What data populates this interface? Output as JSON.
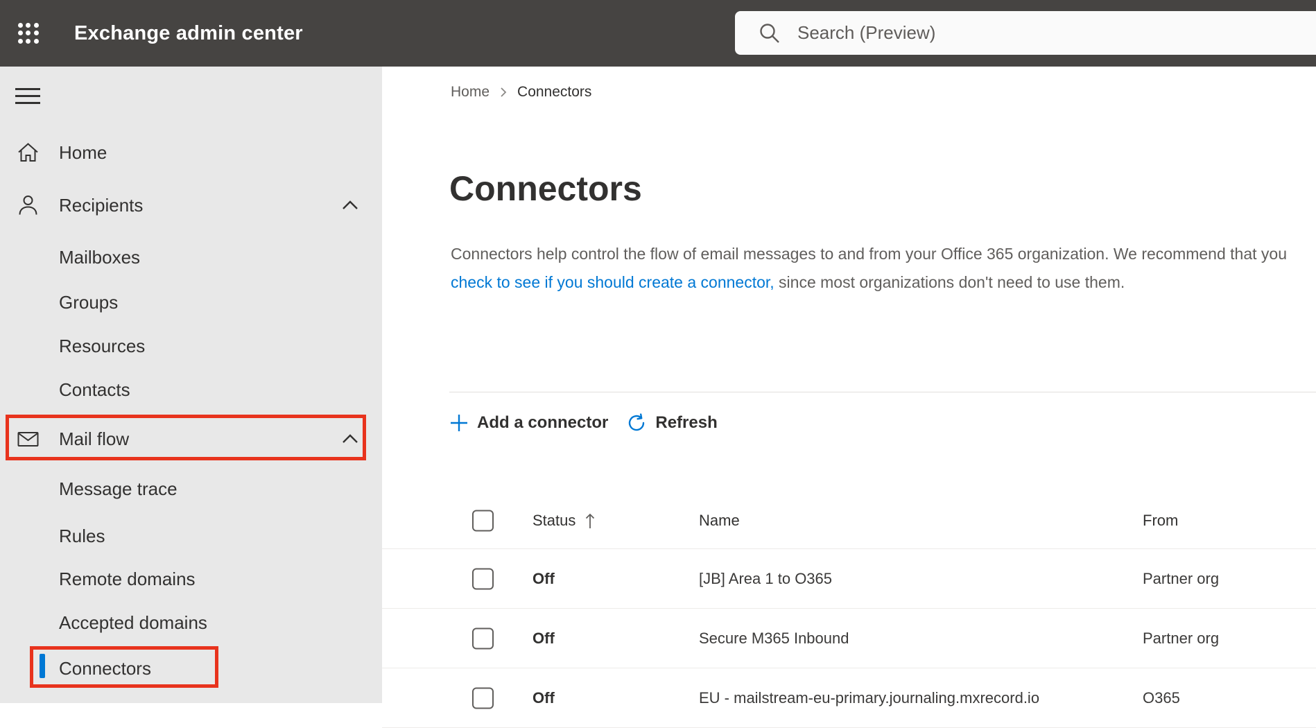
{
  "app": {
    "title": "Exchange admin center",
    "search_placeholder": "Search (Preview)"
  },
  "colors": {
    "topbar_bg": "#464442",
    "sidebar_bg": "#e8e8e8",
    "accent_blue": "#0078d4",
    "link_blue": "#0078d4",
    "annotation_red": "#e8331d",
    "text_dark": "#323130",
    "text_gray": "#605e5c"
  },
  "sidebar": {
    "items": [
      {
        "label": "Home",
        "icon": "home-icon"
      },
      {
        "label": "Recipients",
        "icon": "person-icon",
        "expanded": true
      },
      {
        "label": "Mailboxes"
      },
      {
        "label": "Groups"
      },
      {
        "label": "Resources"
      },
      {
        "label": "Contacts"
      },
      {
        "label": "Mail flow",
        "icon": "mail-icon",
        "expanded": true,
        "annotated": true
      },
      {
        "label": "Message trace"
      },
      {
        "label": "Rules"
      },
      {
        "label": "Remote domains"
      },
      {
        "label": "Accepted domains"
      },
      {
        "label": "Connectors",
        "selected": true,
        "annotated": true
      }
    ]
  },
  "breadcrumb": {
    "home": "Home",
    "current": "Connectors"
  },
  "page": {
    "title": "Connectors",
    "description_before_link": "Connectors help control the flow of email messages to and from your Office 365 organization. We recommend that you ",
    "description_link": "check to see if you should create a connector,",
    "description_after_link": " since most organizations don't need to use them."
  },
  "toolbar": {
    "add_label": "Add a connector",
    "refresh_label": "Refresh"
  },
  "table": {
    "headers": {
      "status": "Status",
      "name": "Name",
      "from": "From"
    },
    "sort": {
      "column": "Status",
      "direction": "ascending"
    },
    "rows": [
      {
        "status": "Off",
        "name": "[JB] Area 1 to O365",
        "from": "Partner org"
      },
      {
        "status": "Off",
        "name": "Secure M365 Inbound",
        "from": "Partner org"
      },
      {
        "status": "Off",
        "name": "EU - mailstream-eu-primary.journaling.mxrecord.io",
        "from": "O365"
      }
    ]
  }
}
